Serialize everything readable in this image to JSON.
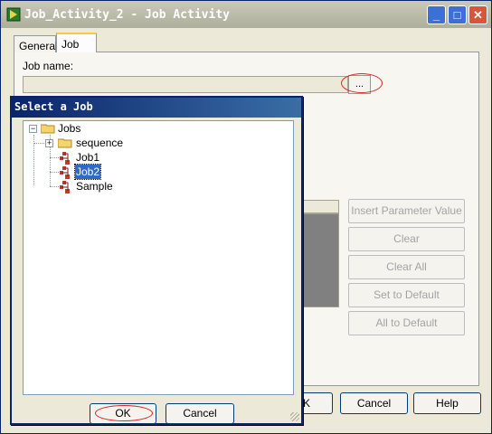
{
  "window": {
    "title": "Job_Activity_2 - Job Activity"
  },
  "title_buttons": {
    "minimize": "_",
    "maximize": "□",
    "close": "✕"
  },
  "tabs": [
    {
      "label": "General"
    },
    {
      "label": "Job"
    }
  ],
  "job_name": {
    "label": "Job name:",
    "value": "",
    "browse_label": "..."
  },
  "side_buttons": {
    "insert_param": "Insert Parameter Value",
    "clear": "Clear",
    "clear_all": "Clear All",
    "set_default": "Set to Default",
    "all_default": "All to Default"
  },
  "bottom_buttons": {
    "ok_partial": "K",
    "cancel": "Cancel",
    "help": "Help"
  },
  "dialog": {
    "title": "Select a Job",
    "tree": {
      "root": "Jobs",
      "children": [
        {
          "label": "sequence",
          "type": "folder",
          "expander": "+"
        },
        {
          "label": "Job1",
          "type": "job"
        },
        {
          "label": "Job2",
          "type": "job",
          "selected": true
        },
        {
          "label": "Sample",
          "type": "job"
        }
      ],
      "root_expander": "−"
    },
    "ok_label": "OK",
    "cancel_label": "Cancel"
  },
  "colors": {
    "annotation": "#dd2222",
    "selection": "#316ac5",
    "title_active": "#0a246a"
  }
}
